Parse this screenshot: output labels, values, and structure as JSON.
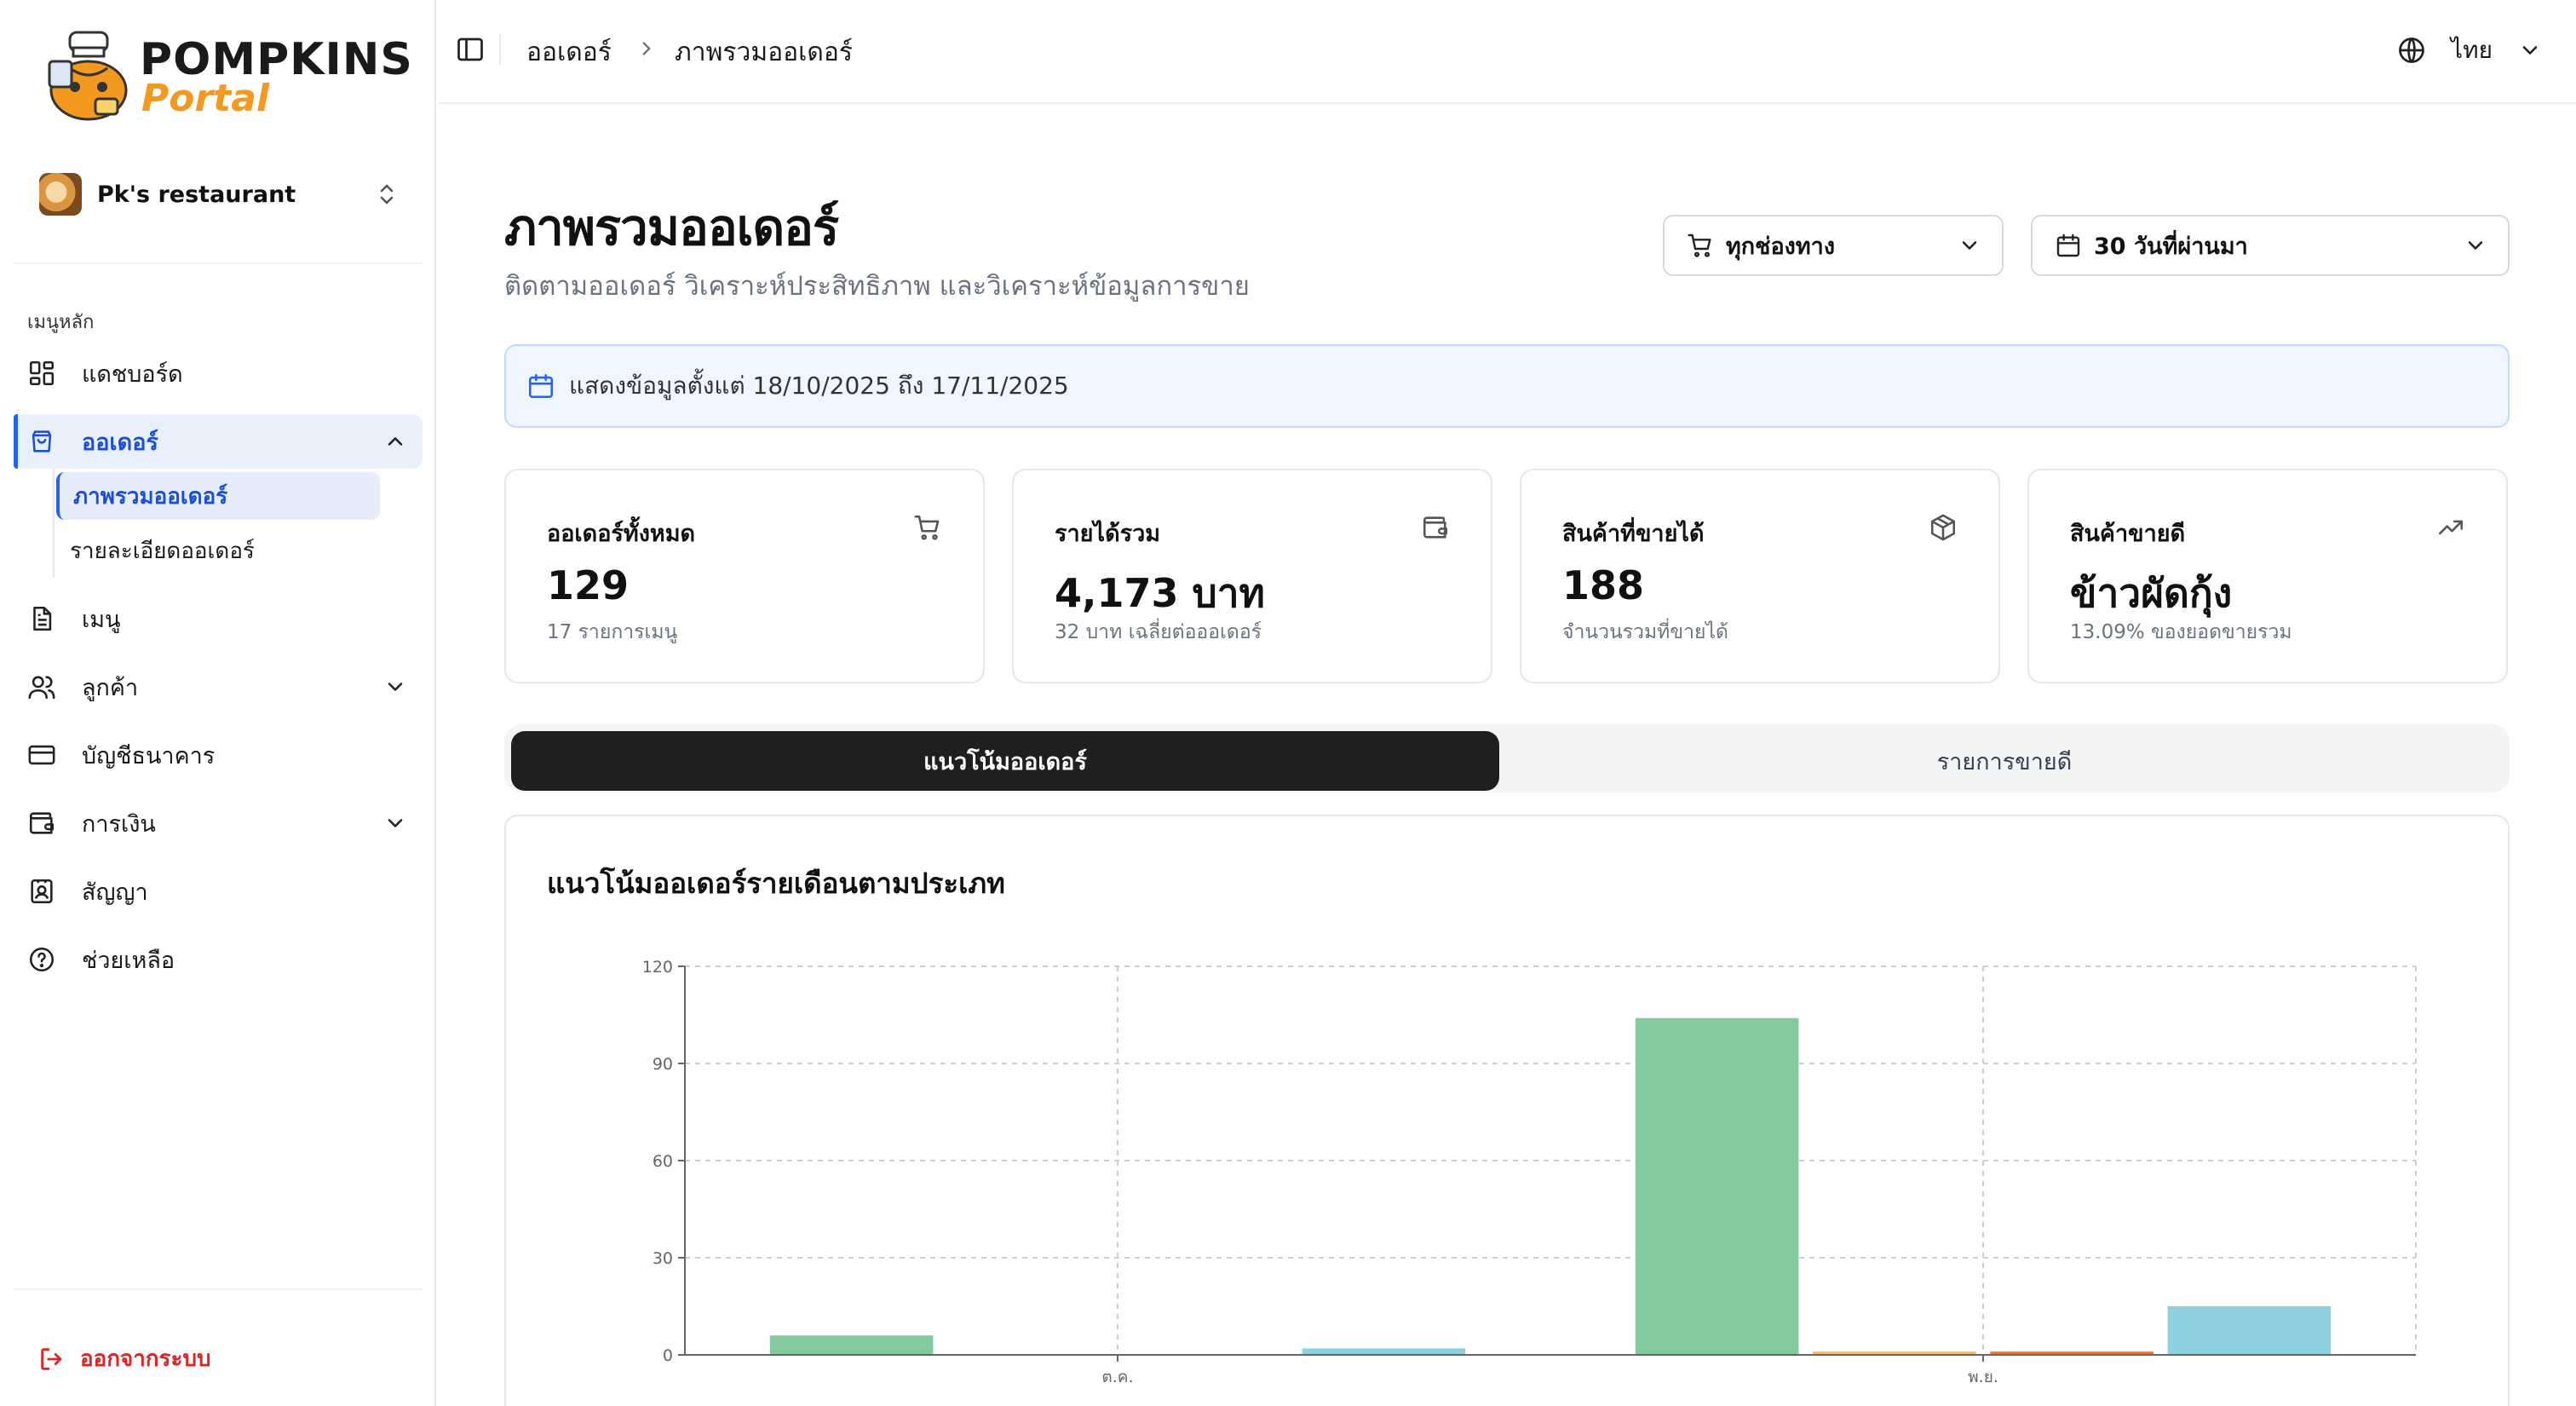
{
  "brand": {
    "name": "POMPKINS",
    "sub": "Portal"
  },
  "store": {
    "name": "Pk's restaurant"
  },
  "sidebar": {
    "section_label": "เมนูหลัก",
    "items": [
      {
        "label": "แดชบอร์ด",
        "icon": "dashboard-icon"
      },
      {
        "label": "ออเดอร์",
        "icon": "shopping-bag-icon",
        "active": true,
        "expanded": true
      },
      {
        "label": "เมนู",
        "icon": "document-icon"
      },
      {
        "label": "ลูกค้า",
        "icon": "users-icon",
        "has_children": true
      },
      {
        "label": "บัญชีธนาคาร",
        "icon": "credit-card-icon"
      },
      {
        "label": "การเงิน",
        "icon": "wallet-icon",
        "has_children": true
      },
      {
        "label": "สัญญา",
        "icon": "contact-card-icon"
      },
      {
        "label": "ช่วยเหลือ",
        "icon": "help-circle-icon"
      }
    ],
    "subitems": [
      {
        "label": "ภาพรวมออเดอร์",
        "active": true
      },
      {
        "label": "รายละเอียดออเดอร์"
      }
    ],
    "logout_label": "ออกจากระบบ"
  },
  "topbar": {
    "breadcrumb": [
      "ออเดอร์",
      "ภาพรวมออเดอร์"
    ],
    "language": "ไทย"
  },
  "page": {
    "title": "ภาพรวมออเดอร์",
    "subtitle": "ติดตามออเดอร์ วิเคราะห์ประสิทธิภาพ และวิเคราะห์ข้อมูลการขาย",
    "channel_filter": "ทุกช่องทาง",
    "date_filter": "30 วันที่ผ่านมา",
    "date_range_notice": "แสดงข้อมูลตั้งแต่ 18/10/2025 ถึง 17/11/2025"
  },
  "stats": [
    {
      "title": "ออเดอร์ทั้งหมด",
      "value": "129",
      "sub": "17 รายการเมนู",
      "icon": "cart-icon"
    },
    {
      "title": "รายได้รวม",
      "value": "4,173 บาท",
      "sub": "32 บาท เฉลี่ยต่อออเดอร์",
      "icon": "wallet-icon"
    },
    {
      "title": "สินค้าที่ขายได้",
      "value": "188",
      "sub": "จำนวนรวมที่ขายได้",
      "icon": "package-icon"
    },
    {
      "title": "สินค้าขายดี",
      "value": "ข้าวผัดกุ้ง",
      "sub": "13.09% ของยอดขายรวม",
      "icon": "trending-up-icon"
    }
  ],
  "tabs": [
    {
      "label": "แนวโน้มออเดอร์",
      "active": true
    },
    {
      "label": "รายการขายดี",
      "active": false
    }
  ],
  "chart_data": {
    "type": "bar",
    "title": "แนวโน้มออเดอร์รายเดือนตามประเภท",
    "categories": [
      "ต.ค.",
      "พ.ย."
    ],
    "ylim": [
      0,
      120
    ],
    "yticks": [
      0,
      30,
      60,
      90,
      120
    ],
    "grid": true,
    "series": [
      {
        "color": "#82ca9d",
        "values": [
          6,
          104
        ]
      },
      {
        "color": "#f5b971",
        "values": [
          0,
          1
        ]
      },
      {
        "color": "#e8743b",
        "values": [
          0,
          1
        ]
      },
      {
        "color": "#8dd1e1",
        "values": [
          2,
          15
        ]
      }
    ]
  }
}
